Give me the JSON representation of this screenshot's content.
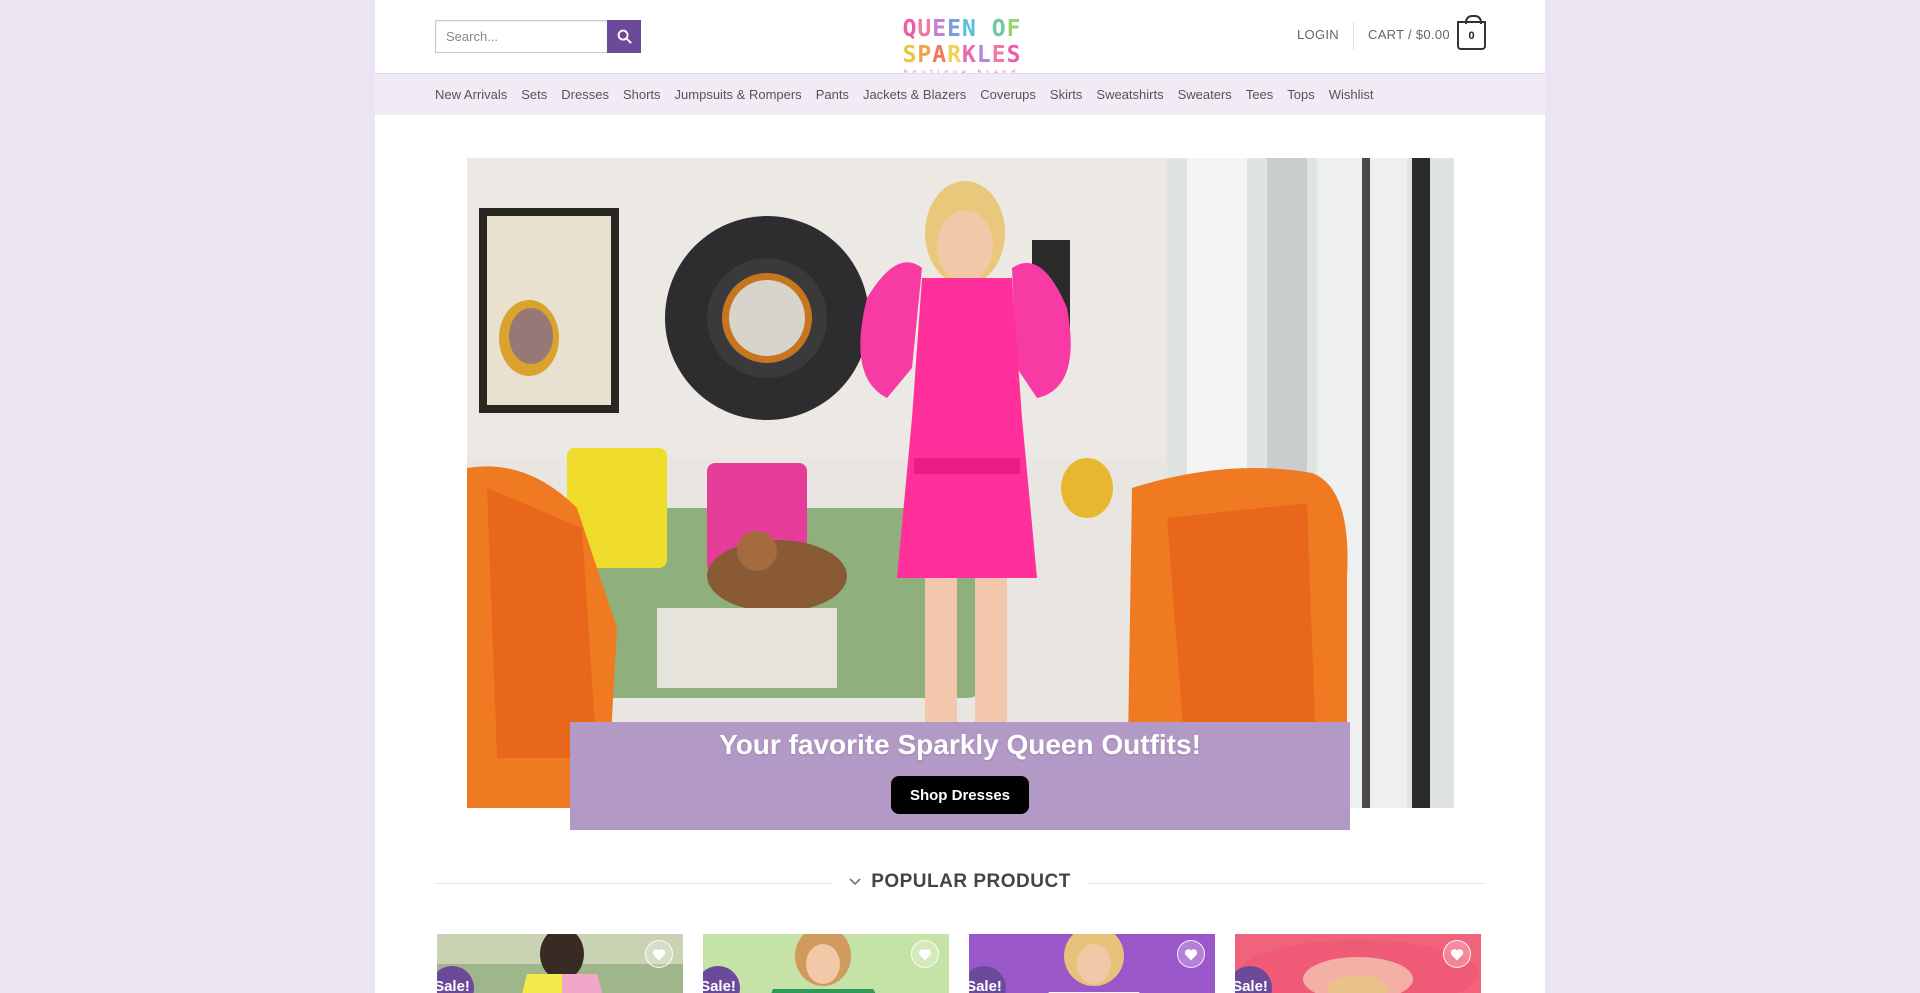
{
  "header": {
    "search": {
      "placeholder": "Search...",
      "value": ""
    },
    "logo": {
      "text": "QUEEN OF SPARKLES",
      "tagline": "boutique brand"
    },
    "login_label": "LOGIN",
    "cart_label": "CART / $0.00",
    "cart_count": "0"
  },
  "nav": {
    "items": [
      {
        "label": "New Arrivals"
      },
      {
        "label": "Sets"
      },
      {
        "label": "Dresses"
      },
      {
        "label": "Shorts"
      },
      {
        "label": "Jumpsuits & Rompers"
      },
      {
        "label": "Pants"
      },
      {
        "label": "Jackets & Blazers"
      },
      {
        "label": "Coverups"
      },
      {
        "label": "Skirts"
      },
      {
        "label": "Sweatshirts"
      },
      {
        "label": "Sweaters"
      },
      {
        "label": "Tees"
      },
      {
        "label": "Tops"
      },
      {
        "label": "Wishlist"
      }
    ]
  },
  "hero": {
    "headline": "Your favorite Sparkly Queen Outfits!",
    "button_label": "Shop Dresses"
  },
  "popular": {
    "title": "POPULAR PRODUCT",
    "products": [
      {
        "badge": "Sale!"
      },
      {
        "badge": "Sale!"
      },
      {
        "badge": "Sale!"
      },
      {
        "badge": "Sale!"
      }
    ]
  },
  "colors": {
    "brand_purple": "#6c4a9a",
    "banner": "#b39ac6",
    "page_bg": "#ebe4f2",
    "nav_bg": "#f1ebf6"
  },
  "icons": {
    "search": "search-icon",
    "wishlist": "heart-icon",
    "section": "chevron-down-icon",
    "cart": "cart-bag-icon"
  }
}
